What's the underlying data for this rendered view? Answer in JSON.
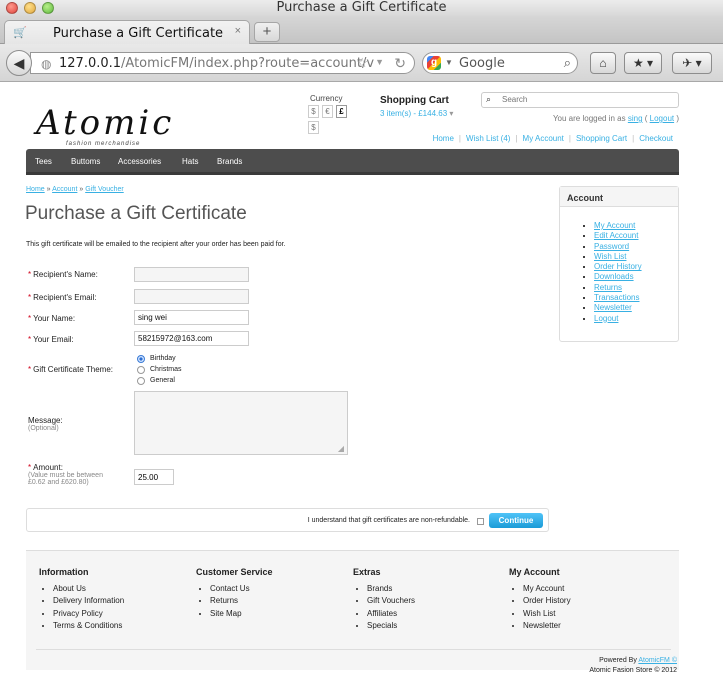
{
  "window": {
    "title": "Purchase a Gift Certificate"
  },
  "tab": {
    "label": "Purchase a Gift Certificate",
    "close": "×",
    "new": "+"
  },
  "nav": {
    "url_host": "127.0.0.1",
    "url_path": "/AtomicFM/index.php?route=account/v",
    "search_engine": "Google"
  },
  "header": {
    "logo": "Atomic",
    "logo_tagline": "fashion merchandise",
    "currency_label": "Currency",
    "currencies": [
      "$",
      "€",
      "£",
      "$"
    ],
    "cart_title": "Shopping Cart",
    "cart_items": "3 item(s) - £144.63",
    "search_placeholder": "Search",
    "welcome_prefix": "You are logged in as",
    "username": "sing",
    "logout": "Logout",
    "links": [
      "Home",
      "Wish List (4)",
      "My Account",
      "Shopping Cart",
      "Checkout"
    ]
  },
  "menu": [
    "Tees",
    "Buttoms",
    "Accessories",
    "Hats",
    "Brands"
  ],
  "breadcrumb": [
    "Home",
    "Account",
    "Gift Voucher"
  ],
  "page": {
    "title": "Purchase a Gift Certificate",
    "intro": "This gift certificate will be emailed to the recipient after your order has been paid for."
  },
  "form": {
    "recipient_name_label": "Recipient's Name:",
    "recipient_name_value": "",
    "recipient_email_label": "Recipient's Email:",
    "recipient_email_value": "",
    "your_name_label": "Your Name:",
    "your_name_value": "sing wei",
    "your_email_label": "Your Email:",
    "your_email_value": "58215972@163.com",
    "theme_label": "Gift Certificate Theme:",
    "themes": [
      "Birthday",
      "Christmas",
      "General"
    ],
    "selected_theme": "Birthday",
    "message_label": "Message:",
    "message_note": "(Optional)",
    "amount_label": "Amount:",
    "amount_note_1": "(Value must be between",
    "amount_note_2": "£0.62 and £620.80)",
    "amount_value": "25.00",
    "agree_text": "I understand that gift certificates are non-refundable.",
    "continue_label": "Continue"
  },
  "sidebar": {
    "title": "Account",
    "items": [
      "My Account",
      "Edit Account",
      "Password",
      "Wish List",
      "Order History",
      "Downloads",
      "Returns",
      "Transactions",
      "Newsletter",
      "Logout"
    ]
  },
  "footer": {
    "columns": [
      {
        "title": "Information",
        "items": [
          "About Us",
          "Delivery Information",
          "Privacy Policy",
          "Terms & Conditions"
        ]
      },
      {
        "title": "Customer Service",
        "items": [
          "Contact Us",
          "Returns",
          "Site Map"
        ]
      },
      {
        "title": "Extras",
        "items": [
          "Brands",
          "Gift Vouchers",
          "Affiliates",
          "Specials"
        ]
      },
      {
        "title": "My Account",
        "items": [
          "My Account",
          "Order History",
          "Wish List",
          "Newsletter"
        ]
      }
    ],
    "powered_prefix": "Powered By",
    "powered_link": "AtomicFM ©",
    "copyright": "Atomic Fasion Store © 2012"
  },
  "colors": {
    "accent": "#38b0e3",
    "menu_bg": "#4d4d4d",
    "required": "#d0021b",
    "button": "#1b9bd7"
  }
}
